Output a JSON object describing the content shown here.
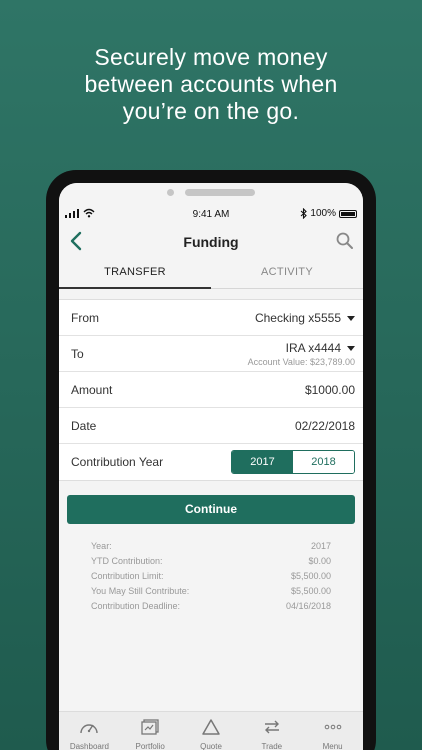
{
  "headline": {
    "line1": "Securely move money",
    "line2": "between accounts when",
    "line3": "you’re on the go."
  },
  "status_bar": {
    "time": "9:41 AM",
    "battery": "100%"
  },
  "nav": {
    "title": "Funding",
    "back_icon": "chevron-left-icon",
    "search_icon": "search-icon"
  },
  "tabs": [
    {
      "label": "TRANSFER",
      "active": true
    },
    {
      "label": "ACTIVITY",
      "active": false
    }
  ],
  "form": {
    "from": {
      "label": "From",
      "value": "Checking x5555"
    },
    "to": {
      "label": "To",
      "value": "IRA x4444",
      "sub": "Account Value: $23,789.00"
    },
    "amount": {
      "label": "Amount",
      "value": "$1000.00"
    },
    "date": {
      "label": "Date",
      "value": "02/22/2018"
    },
    "contribution_year": {
      "label": "Contribution Year",
      "options": [
        "2017",
        "2018"
      ],
      "selected": "2017"
    }
  },
  "continue_label": "Continue",
  "summary": [
    {
      "label": "Year:",
      "value": "2017"
    },
    {
      "label": "YTD Contribution:",
      "value": "$0.00"
    },
    {
      "label": "Contribution Limit:",
      "value": "$5,500.00"
    },
    {
      "label": "You May Still Contribute:",
      "value": "$5,500.00"
    },
    {
      "label": "Contribution Deadline:",
      "value": "04/16/2018"
    }
  ],
  "tabbar": [
    {
      "label": "Dashboard",
      "icon": "gauge-icon"
    },
    {
      "label": "Portfolio",
      "icon": "portfolio-icon"
    },
    {
      "label": "Quote",
      "icon": "triangle-icon"
    },
    {
      "label": "Trade",
      "icon": "swap-arrows-icon"
    },
    {
      "label": "Menu",
      "icon": "more-dots-icon"
    }
  ],
  "colors": {
    "accent": "#1f6e5e",
    "background": "#2a6a5c"
  }
}
